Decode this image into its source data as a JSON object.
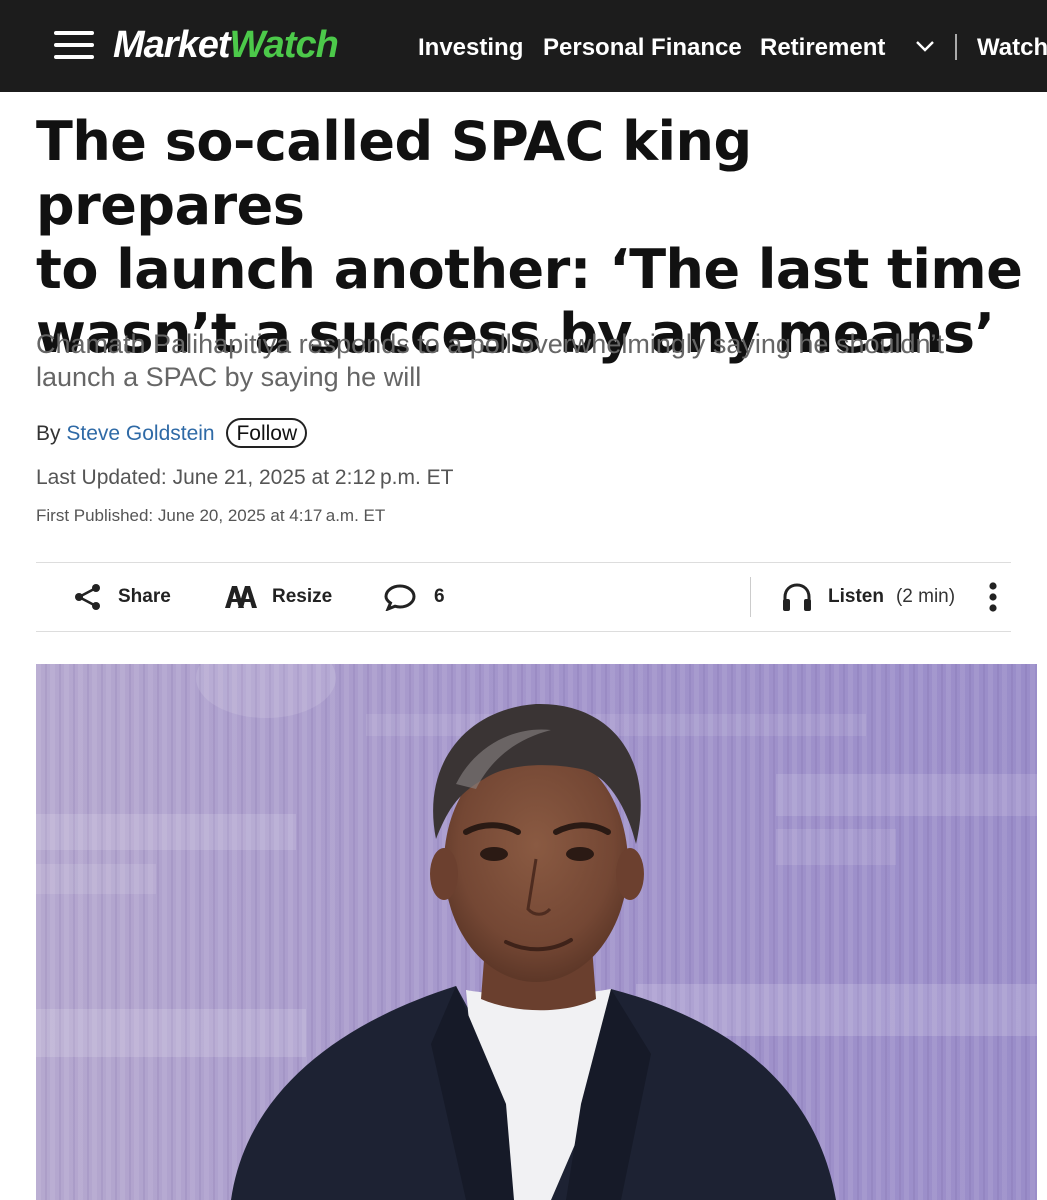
{
  "navbar": {
    "logo_part1": "Market",
    "logo_part2": "Watch",
    "links": [
      "Investing",
      "Personal Finance",
      "Retirement",
      "Watch"
    ]
  },
  "article": {
    "headline_lines": [
      "The so-called SPAC king prepares",
      "to launch another: ‘The last time",
      "wasn’t a success by any means’"
    ],
    "dek_lines": [
      "Chamath Palihapitiya responds to a poll overwhelmingly saying he shouldn’t",
      "launch a SPAC by saying he will"
    ],
    "by_prefix": "By",
    "author": "Steve Goldstein",
    "follow_label": "Follow",
    "last_updated": "Last Updated: June 21, 2025 at 2:12 p.m. ET",
    "first_published": "First Published: June 20, 2025 at 4:17 a.m. ET"
  },
  "toolbar": {
    "share": "Share",
    "resize": "Resize",
    "comments_count": "6",
    "listen": "Listen",
    "listen_duration": "(2 min)"
  },
  "colors": {
    "nav_bg": "#1c1c1c",
    "logo_accent": "#4cc94a",
    "author_link": "#2f6aa6"
  },
  "icons": [
    "menu-icon",
    "chevron-down-icon",
    "share-icon",
    "resize-icon",
    "comment-icon",
    "headphones-icon",
    "more-vertical-icon"
  ]
}
